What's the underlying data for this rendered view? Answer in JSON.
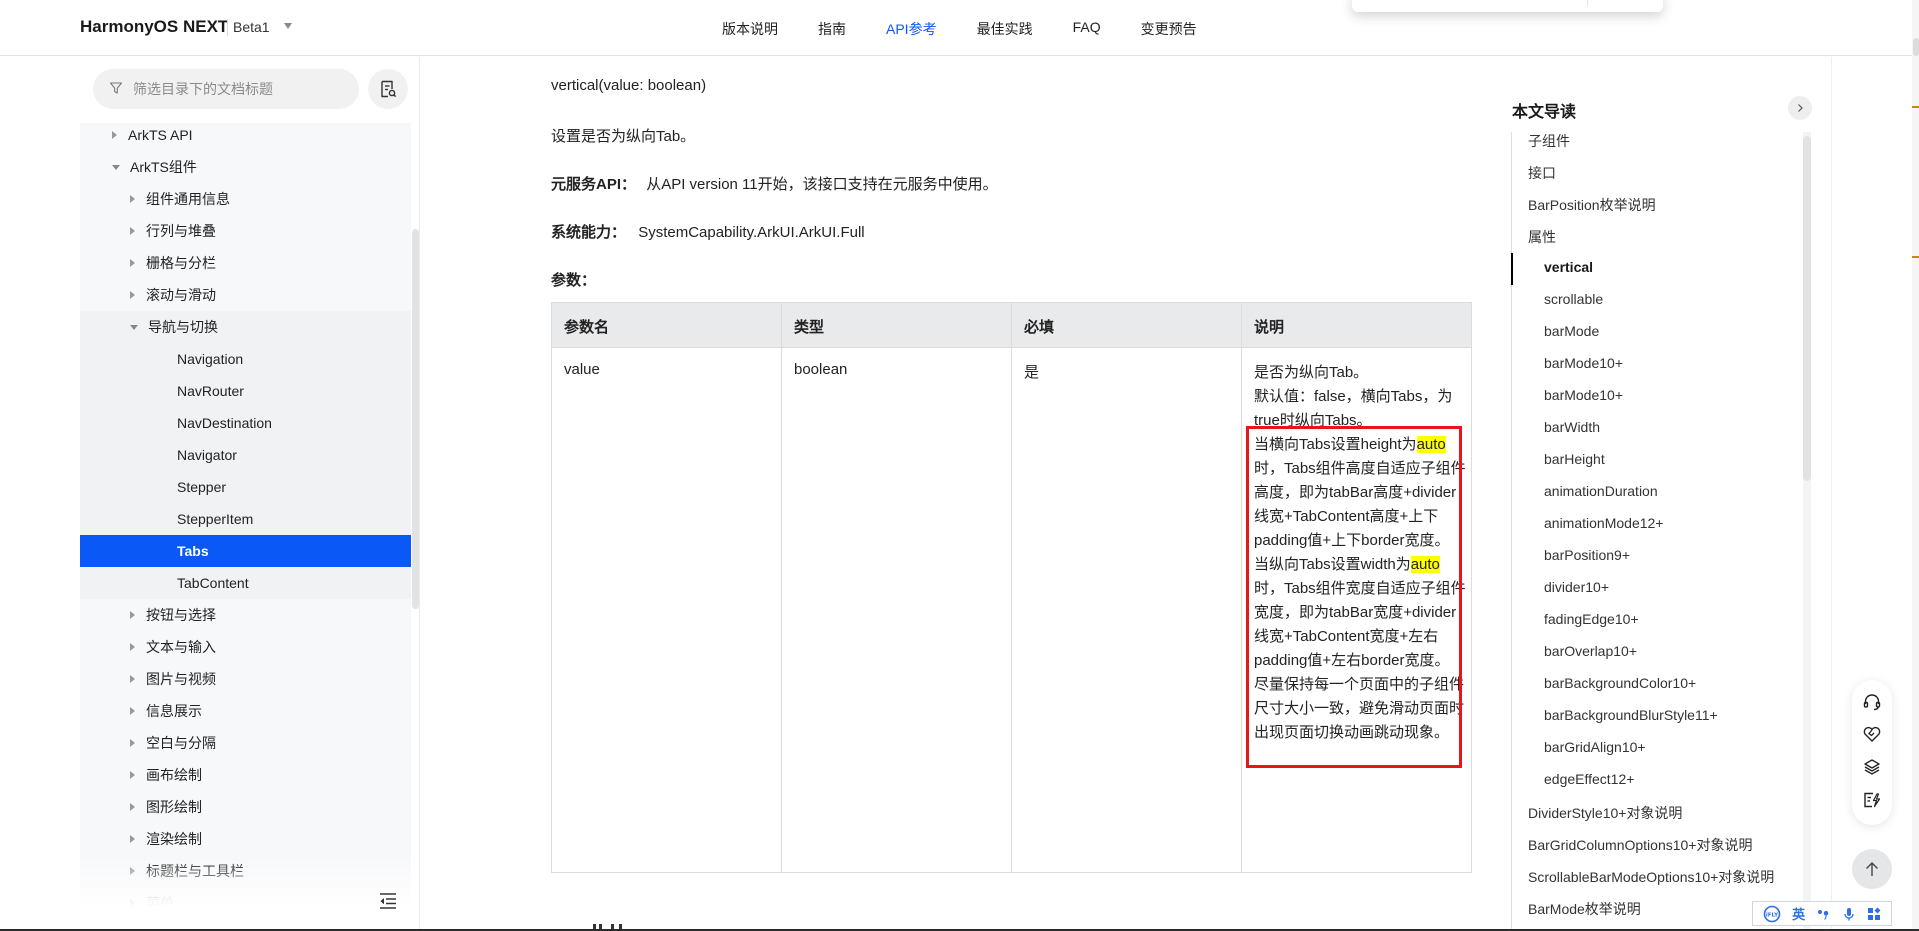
{
  "header": {
    "brand": "HarmonyOS NEXT",
    "version": "Beta1",
    "nav": [
      {
        "label": "版本说明",
        "active": false
      },
      {
        "label": "指南",
        "active": false
      },
      {
        "label": "API参考",
        "active": true
      },
      {
        "label": "最佳实践",
        "active": false
      },
      {
        "label": "FAQ",
        "active": false
      },
      {
        "label": "变更预告",
        "active": false
      }
    ]
  },
  "sidebar": {
    "filter_placeholder": "筛选目录下的文档标题",
    "tree": [
      {
        "label": "ArkTS API",
        "level": 1,
        "state": "collapsed"
      },
      {
        "label": "ArkTS组件",
        "level": 1,
        "state": "expanded"
      },
      {
        "label": "组件通用信息",
        "level": 2,
        "state": "collapsed"
      },
      {
        "label": "行列与堆叠",
        "level": 2,
        "state": "collapsed"
      },
      {
        "label": "栅格与分栏",
        "level": 2,
        "state": "collapsed"
      },
      {
        "label": "滚动与滑动",
        "level": 2,
        "state": "collapsed"
      },
      {
        "label": "导航与切换",
        "level": 2,
        "state": "expanded"
      },
      {
        "label": "Navigation",
        "level": 3,
        "state": "leaf"
      },
      {
        "label": "NavRouter",
        "level": 3,
        "state": "leaf"
      },
      {
        "label": "NavDestination",
        "level": 3,
        "state": "leaf"
      },
      {
        "label": "Navigator",
        "level": 3,
        "state": "leaf"
      },
      {
        "label": "Stepper",
        "level": 3,
        "state": "leaf"
      },
      {
        "label": "StepperItem",
        "level": 3,
        "state": "leaf"
      },
      {
        "label": "Tabs",
        "level": 3,
        "state": "selected"
      },
      {
        "label": "TabContent",
        "level": 3,
        "state": "leaf"
      },
      {
        "label": "按钮与选择",
        "level": 2,
        "state": "collapsed"
      },
      {
        "label": "文本与输入",
        "level": 2,
        "state": "collapsed"
      },
      {
        "label": "图片与视频",
        "level": 2,
        "state": "collapsed"
      },
      {
        "label": "信息展示",
        "level": 2,
        "state": "collapsed"
      },
      {
        "label": "空白与分隔",
        "level": 2,
        "state": "collapsed"
      },
      {
        "label": "画布绘制",
        "level": 2,
        "state": "collapsed"
      },
      {
        "label": "图形绘制",
        "level": 2,
        "state": "collapsed"
      },
      {
        "label": "渲染绘制",
        "level": 2,
        "state": "collapsed"
      },
      {
        "label": "标题栏与工具栏",
        "level": 2,
        "state": "collapsed"
      },
      {
        "label": "菜单",
        "level": 2,
        "state": "collapsed"
      }
    ]
  },
  "content": {
    "signature": "vertical(value: boolean)",
    "summary": "设置是否为纵向Tab。",
    "atomic_label": "元服务API：",
    "atomic_text": "从API version 11开始，该接口支持在元服务中使用。",
    "syscap_label": "系统能力：",
    "syscap_text": "SystemCapability.ArkUI.ArkUI.Full",
    "params_label": "参数：",
    "table": {
      "headers": [
        "参数名",
        "类型",
        "必填",
        "说明"
      ],
      "rows": [
        {
          "name": "value",
          "type": "boolean",
          "required": "是",
          "desc": {
            "line1": "是否为纵向Tab。",
            "line2": "默认值：false，横向Tabs，为true时纵向Tabs。",
            "p3_pre": "当横向Tabs设置height为",
            "p3_hl": "auto",
            "p3_post": "时，Tabs组件高度自适应子组件高度，即为tabBar高度+divider线宽+TabContent高度+上下padding值+上下border宽度。",
            "p4_pre": "当纵向Tabs设置width为",
            "p4_hl": "auto",
            "p4_post": "时，Tabs组件宽度自适应子组件宽度，即为tabBar宽度+divider线宽+TabContent宽度+左右padding值+左右border宽度。",
            "p5": "尽量保持每一个页面中的子组件尺寸大小一致，避免滑动页面时出现页面切换动画跳动现象。"
          }
        }
      ]
    }
  },
  "toc": {
    "title": "本文导读",
    "items": [
      {
        "label": "子组件",
        "level": "top"
      },
      {
        "label": "接口",
        "level": "top"
      },
      {
        "label": "BarPosition枚举说明",
        "level": "top"
      },
      {
        "label": "属性",
        "level": "top"
      },
      {
        "label": "vertical",
        "level": "sub",
        "active": true
      },
      {
        "label": "scrollable",
        "level": "sub"
      },
      {
        "label": "barMode",
        "level": "sub"
      },
      {
        "label": "barMode10+",
        "level": "sub"
      },
      {
        "label": "barMode10+",
        "level": "sub"
      },
      {
        "label": "barWidth",
        "level": "sub"
      },
      {
        "label": "barHeight",
        "level": "sub"
      },
      {
        "label": "animationDuration",
        "level": "sub"
      },
      {
        "label": "animationMode12+",
        "level": "sub"
      },
      {
        "label": "barPosition9+",
        "level": "sub"
      },
      {
        "label": "divider10+",
        "level": "sub"
      },
      {
        "label": "fadingEdge10+",
        "level": "sub"
      },
      {
        "label": "barOverlap10+",
        "level": "sub"
      },
      {
        "label": "barBackgroundColor10+",
        "level": "sub"
      },
      {
        "label": "barBackgroundBlurStyle11+",
        "level": "sub"
      },
      {
        "label": "barGridAlign10+",
        "level": "sub"
      },
      {
        "label": "edgeEffect12+",
        "level": "sub"
      },
      {
        "label": "DividerStyle10+对象说明",
        "level": "top"
      },
      {
        "label": "BarGridColumnOptions10+对象说明",
        "level": "top"
      },
      {
        "label": "ScrollableBarModeOptions10+对象说明",
        "level": "top"
      },
      {
        "label": "BarMode枚举说明",
        "level": "top"
      }
    ]
  },
  "float_tools": [
    "headset-icon",
    "heart-handshake-icon",
    "layers-icon",
    "feedback-edit-icon"
  ],
  "ime": {
    "logo": "iFLY",
    "mode": "英"
  },
  "colors": {
    "accent": "#0a59f7",
    "highlight": "#ffff00",
    "annotation_box": "#e8161b"
  }
}
